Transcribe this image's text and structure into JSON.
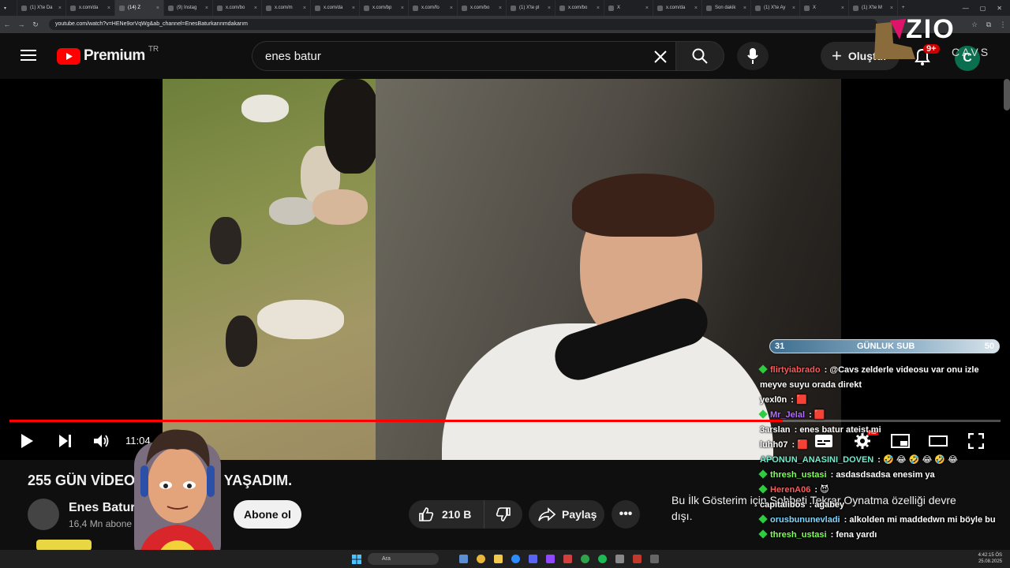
{
  "browser": {
    "tabs": [
      {
        "label": "(1) X'te Da"
      },
      {
        "label": "x.com/da"
      },
      {
        "label": "(14) Z"
      },
      {
        "label": "(9) Instag"
      },
      {
        "label": "x.com/bo"
      },
      {
        "label": "x.com/m"
      },
      {
        "label": "x.com/da"
      },
      {
        "label": "x.com/bp"
      },
      {
        "label": "x.com/fo"
      },
      {
        "label": "x.com/bo"
      },
      {
        "label": "(1) X'te pl"
      },
      {
        "label": "x.com/bo"
      },
      {
        "label": "X"
      },
      {
        "label": "x.com/da"
      },
      {
        "label": "Son dakik"
      },
      {
        "label": "(1) X'te Ay"
      },
      {
        "label": "X"
      },
      {
        "label": "(1) X'te M"
      }
    ],
    "new_tab": "+",
    "url": "youtube.com/watch?v=HENe9orVqWg&ab_channel=EnesBaturkarınmdakarım"
  },
  "youtube": {
    "logo_text": "Premium",
    "region": "TR",
    "search_value": "enes batur",
    "create_label": "Oluştur",
    "notification_count": "9+",
    "avatar_letter": "C"
  },
  "player": {
    "time": "11:04",
    "progress": 0.78,
    "hd_badge": "HD"
  },
  "video": {
    "title": "255 GÜN VİDEO ÇEKMEDEN YAŞADIM.",
    "channel_name": "Enes Batur",
    "subscribers": "16,4 Mn abone",
    "subscribe_label": "Abone ol",
    "likes": "210 B",
    "share_label": "Paylaş",
    "premiere_message": "Bu İlk Gösterim için Sohbeti Tekrar Oynatma özelliği devre dışı."
  },
  "overlay": {
    "logo_text": "ZIO",
    "logo_sub": "CAVS",
    "sub_goal": {
      "current": "31",
      "label": "GÜNLUK SUB",
      "target": "50",
      "fraction": 0.62
    }
  },
  "chat": [
    {
      "user": "flirtyiabrado",
      "text": "@Cavs zelderle videosu var onu izle meyve suyu orada direkt",
      "color": "#ff5a5a",
      "badge": true
    },
    {
      "user": "yexl0n",
      "text": "🟥",
      "color": "#ffffff",
      "badge": false
    },
    {
      "user": "Mr_Jelal",
      "text": "🟥",
      "color": "#b56cff",
      "badge": true
    },
    {
      "user": "3arslan",
      "text": "enes batur ateist mi",
      "color": "#ffffff",
      "badge": false
    },
    {
      "user": "luhh07",
      "text": "🟥",
      "color": "#ffffff",
      "badge": false
    },
    {
      "user": "APONUN_ANASINI_DOVEN",
      "text": "🤣 😂 🤣 😂 🤣 😂",
      "color": "#6df0d0",
      "badge": false
    },
    {
      "user": "thresh_ustasi",
      "text": "asdasdsadsa enesim ya",
      "color": "#7fff5a",
      "badge": true
    },
    {
      "user": "HerenA06",
      "text": "😈",
      "color": "#ff5a5a",
      "badge": true
    },
    {
      "user": "capitalibos",
      "text": "agabey",
      "color": "#ffffff",
      "badge": false
    },
    {
      "user": "orusbununevladi",
      "text": "alkolden mi maddedwn mi böyle bu",
      "color": "#7fd7ff",
      "badge": true
    },
    {
      "user": "thresh_ustasi",
      "text": "fena yardı",
      "color": "#7fff5a",
      "badge": true
    }
  ],
  "taskbar": {
    "search_placeholder": "Ara",
    "clock_time": "4:42:15 ÖS",
    "clock_date": "25.08.2025"
  },
  "colors": {
    "youtube_red": "#ff0000",
    "background": "#0f0f0f",
    "chip": "#272727"
  }
}
